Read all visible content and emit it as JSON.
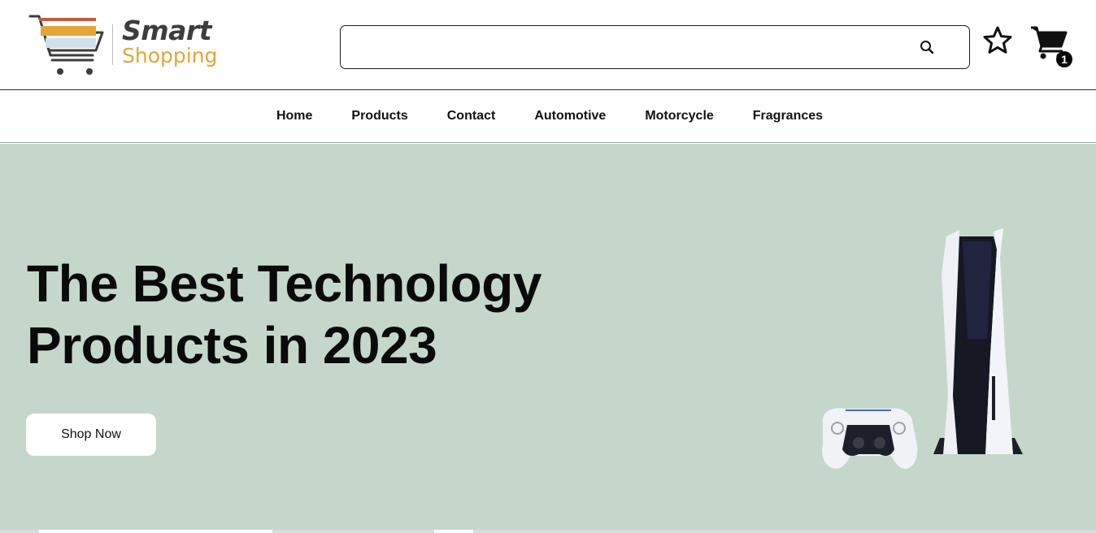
{
  "brand": {
    "name_line1": "Smart",
    "name_line2": "Shopping",
    "accent_color": "#e3a537",
    "logo_icon": "shopping-cart-logo-icon"
  },
  "search": {
    "value": "",
    "placeholder": "",
    "icon": "search-icon"
  },
  "header_actions": {
    "favorites_icon": "star-icon",
    "cart_icon": "cart-icon",
    "cart_count": "1"
  },
  "nav": {
    "items": [
      {
        "label": "Home"
      },
      {
        "label": "Products"
      },
      {
        "label": "Contact"
      },
      {
        "label": "Automotive"
      },
      {
        "label": "Motorcycle"
      },
      {
        "label": "Fragrances"
      }
    ]
  },
  "hero": {
    "title_line1": "The Best Technology",
    "title_line2": "Products in 2023",
    "cta_label": "Shop Now",
    "background": "#c5d7cb",
    "image": "game-console-with-controller"
  }
}
